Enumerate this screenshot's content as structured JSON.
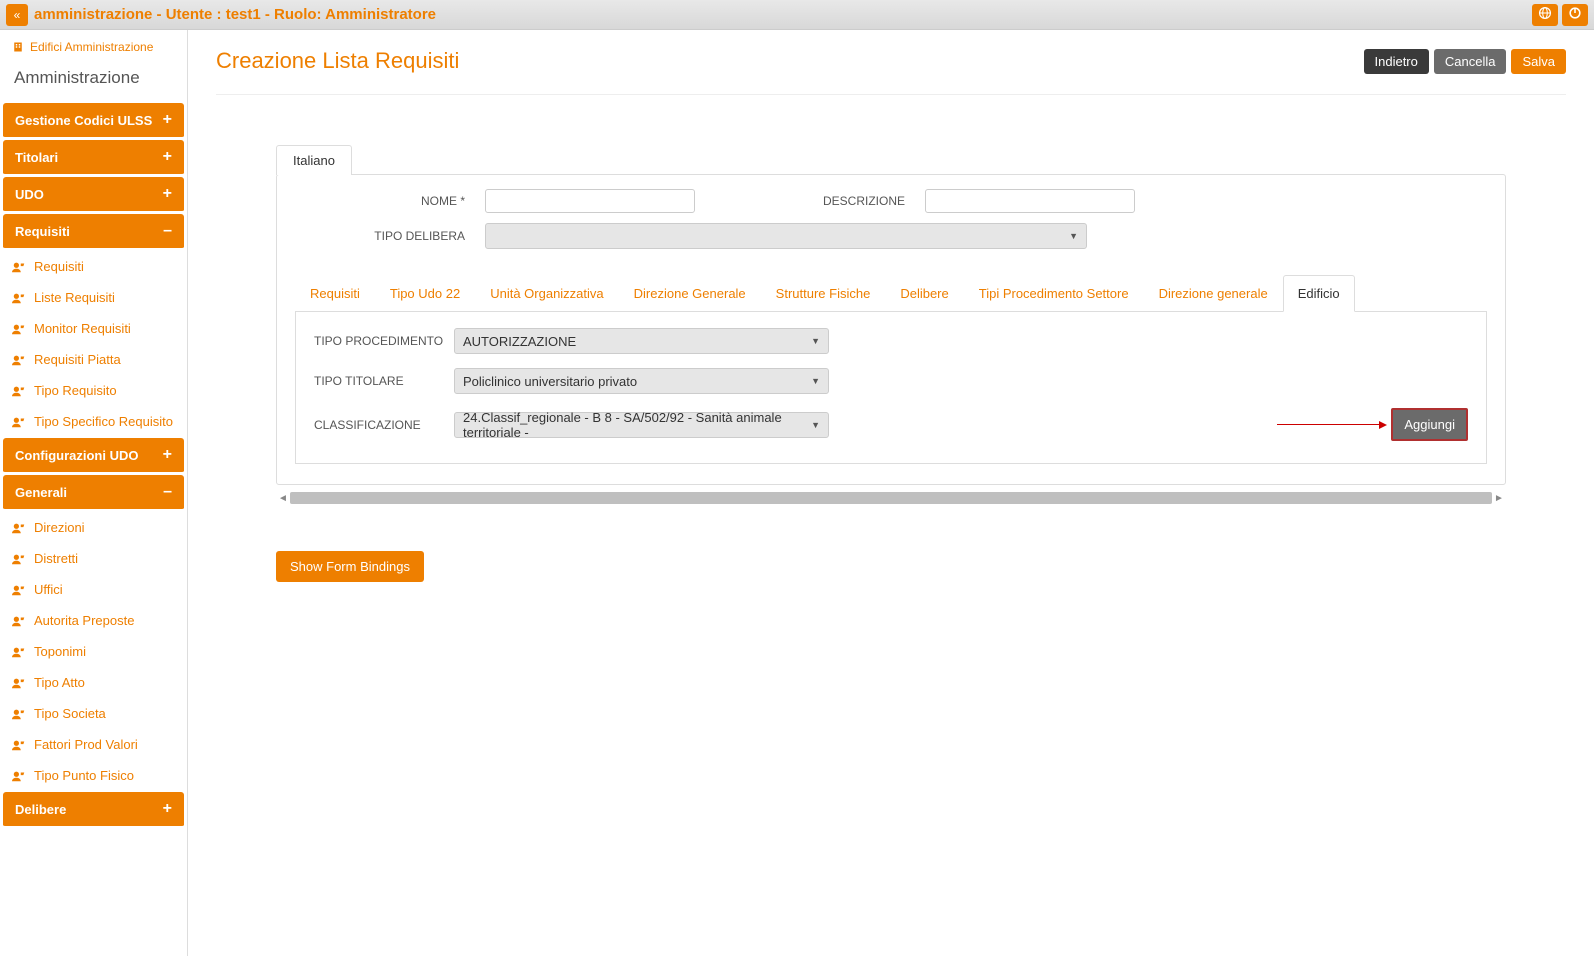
{
  "topbar": {
    "title": "amministrazione - Utente : test1 - Ruolo: Amministratore"
  },
  "sidebar": {
    "breadcrumb": "Edifici Amministrazione",
    "admin_label": "Amministrazione",
    "sections": [
      {
        "label": "Gestione Codici ULSS",
        "state": "+"
      },
      {
        "label": "Titolari",
        "state": "+"
      },
      {
        "label": "UDO",
        "state": "+"
      },
      {
        "label": "Requisiti",
        "state": "–",
        "items": [
          "Requisiti",
          "Liste Requisiti",
          "Monitor Requisiti",
          "Requisiti Piatta",
          "Tipo Requisito",
          "Tipo Specifico Requisito"
        ]
      },
      {
        "label": "Configurazioni UDO",
        "state": "+"
      },
      {
        "label": "Generali",
        "state": "–",
        "items": [
          "Direzioni",
          "Distretti",
          "Uffici",
          "Autorita Preposte",
          "Toponimi",
          "Tipo Atto",
          "Tipo Societa",
          "Fattori Prod Valori",
          "Tipo Punto Fisico"
        ]
      },
      {
        "label": "Delibere",
        "state": "+"
      }
    ]
  },
  "main": {
    "page_title": "Creazione Lista Requisiti",
    "buttons": {
      "back": "Indietro",
      "cancel": "Cancella",
      "save": "Salva"
    },
    "top_tab": "Italiano",
    "fields": {
      "nome_label": "NOME *",
      "nome_value": "",
      "descrizione_label": "DESCRIZIONE",
      "descrizione_value": "",
      "tipo_delibera_label": "TIPO DELIBERA",
      "tipo_delibera_value": ""
    },
    "tabs": [
      "Requisiti",
      "Tipo Udo 22",
      "Unità Organizzativa",
      "Direzione Generale",
      "Strutture Fisiche",
      "Delibere",
      "Tipi Procedimento Settore",
      "Direzione generale",
      "Edificio"
    ],
    "active_tab": "Edificio",
    "edificio": {
      "tipo_procedimento_label": "TIPO PROCEDIMENTO",
      "tipo_procedimento_value": "AUTORIZZAZIONE",
      "tipo_titolare_label": "TIPO TITOLARE",
      "tipo_titolare_value": "Policlinico universitario privato",
      "classificazione_label": "CLASSIFICAZIONE",
      "classificazione_value": "24.Classif_regionale - B 8 - SA/502/92 - Sanità animale territoriale -",
      "aggiungi": "Aggiungi"
    },
    "show_bindings": "Show Form Bindings"
  }
}
